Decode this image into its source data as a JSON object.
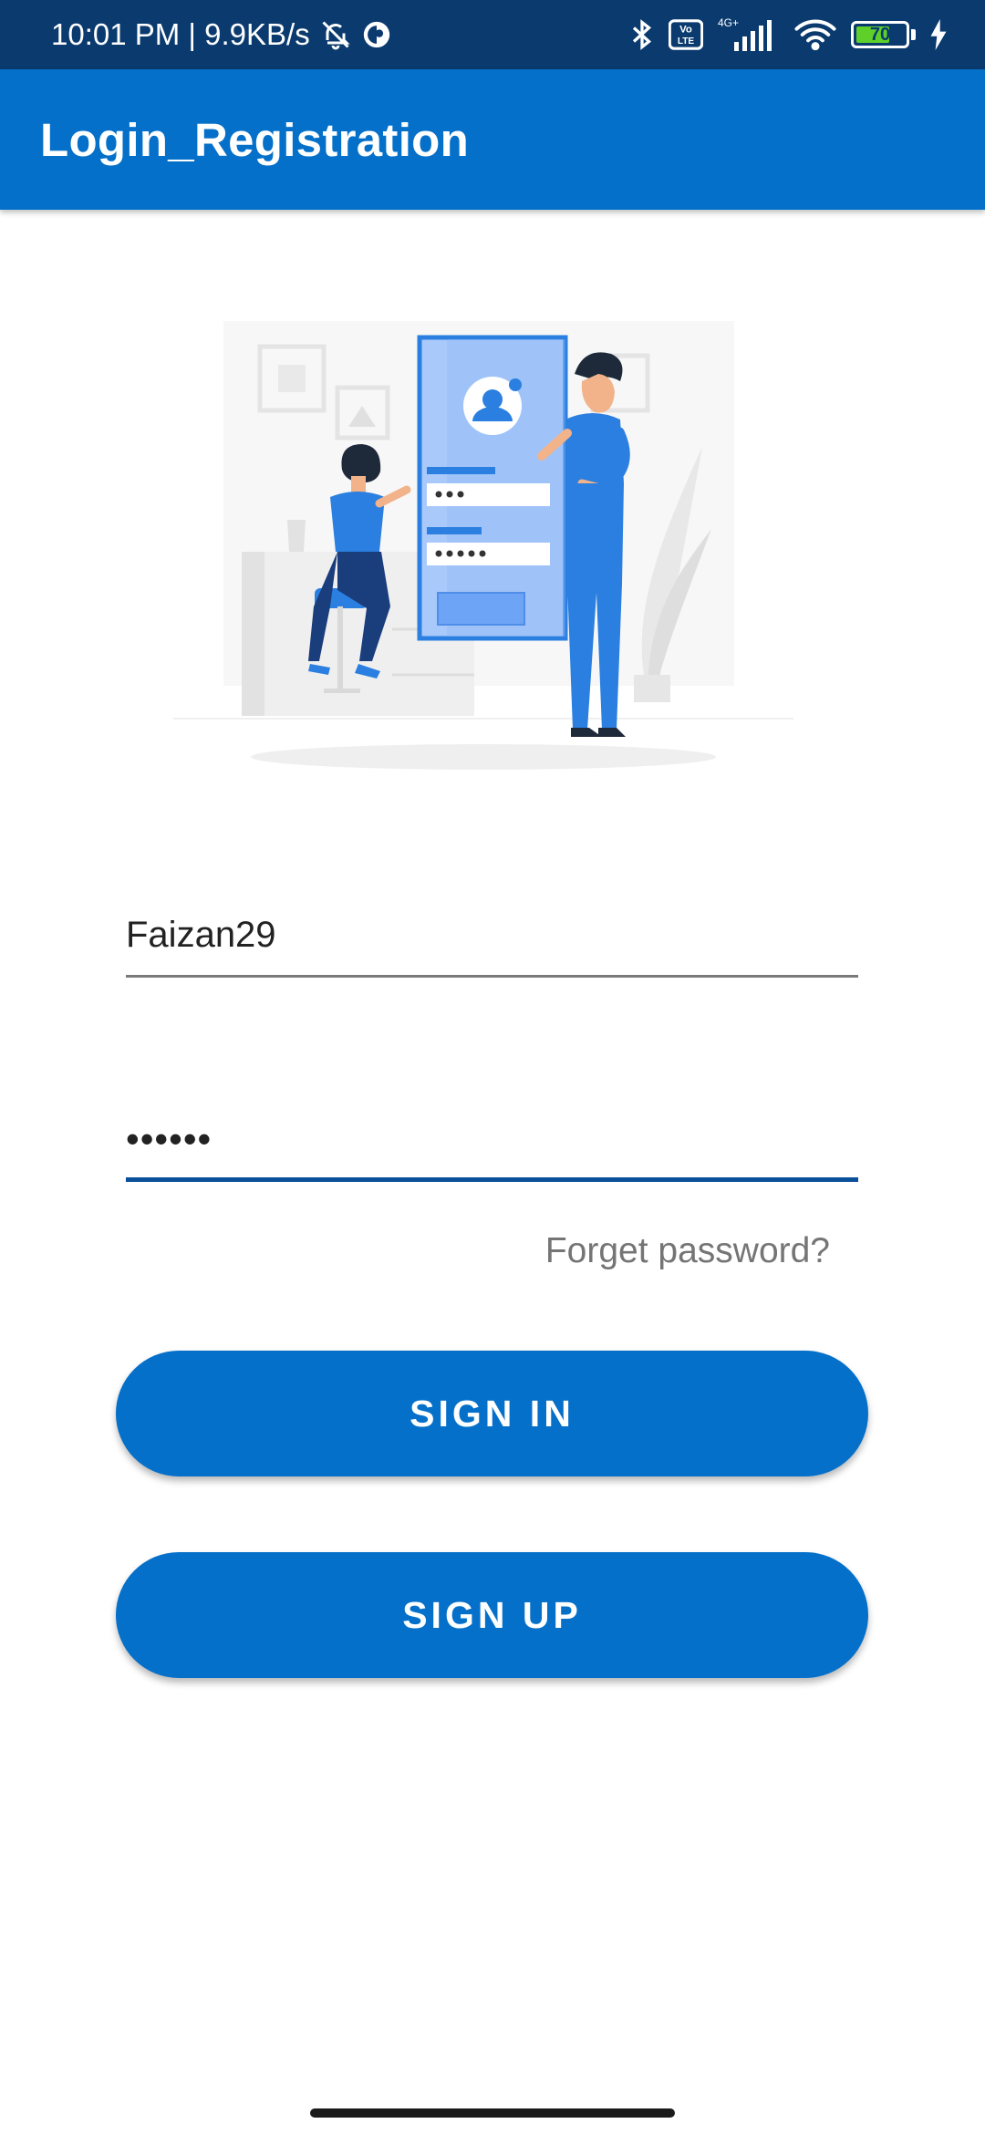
{
  "status_bar": {
    "time_speed": "10:01 PM | 9.9KB/s",
    "network": "4G+",
    "volte": "Vo LTE",
    "battery": "70",
    "battery_level": 0.7
  },
  "app_bar": {
    "title": "Login_Registration"
  },
  "login": {
    "username_value": "Faizan29",
    "password_value": "••••••",
    "forgot_label": "Forget password?",
    "signin_label": "SIGN IN",
    "signup_label": "SIGN UP"
  },
  "colors": {
    "primary": "#0570c9",
    "status_bar": "#0a3a6e",
    "focus_underline": "#0a4f9a"
  }
}
